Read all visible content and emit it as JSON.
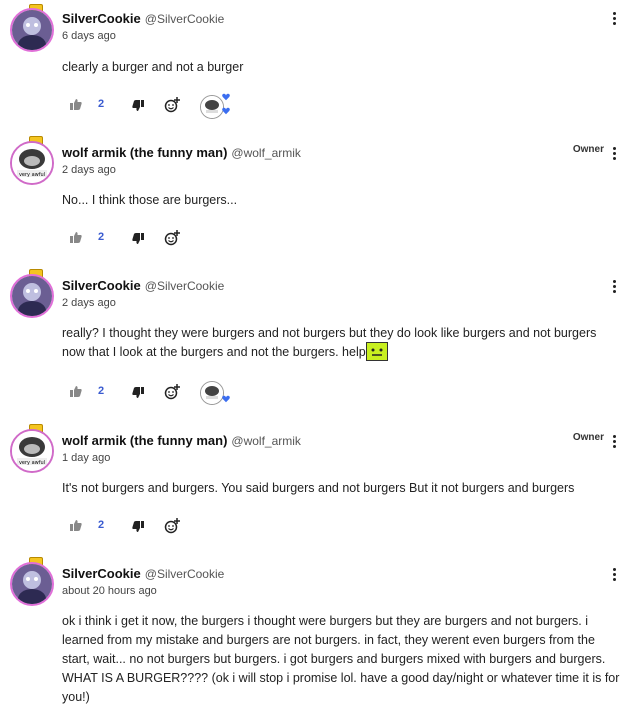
{
  "comments": [
    {
      "author": "SilverCookie",
      "handle": "@SilverCookie",
      "time": "6 days ago",
      "owner": "",
      "text": "clearly a burger and not a burger",
      "likes": "2",
      "avatar_type": "silver"
    },
    {
      "author": "wolf armik (the funny man)",
      "handle": "@wolf_armik",
      "time": "2 days ago",
      "owner": "Owner",
      "text": "No... I think those are burgers...",
      "likes": "2",
      "avatar_type": "wolf"
    },
    {
      "author": "SilverCookie",
      "handle": "@SilverCookie",
      "time": "2 days ago",
      "owner": "",
      "text": "really? I thought they were burgers and not burgers but they do look like burgers and not burgers now that I look at the burgers and not the burgers. help",
      "likes": "2",
      "avatar_type": "silver"
    },
    {
      "author": "wolf armik (the funny man)",
      "handle": "@wolf_armik",
      "time": "1 day ago",
      "owner": "Owner",
      "text": "It's not burgers and burgers. You said  burgers and not burgers But it not burgers and burgers",
      "likes": "2",
      "avatar_type": "wolf"
    },
    {
      "author": "SilverCookie",
      "handle": "@SilverCookie",
      "time": "about 20 hours ago",
      "owner": "",
      "text": "ok i think i get it now, the burgers i thought were burgers but they are burgers and not burgers. i learned from my mistake and burgers are not burgers. in fact, they werent even burgers from the start, wait... no not burgers but burgers. i got burgers and burgers mixed with burgers and burgers. WHAT IS A BURGER???? (ok i will stop i promise lol. have a good day/night or whatever time it is for you!)",
      "likes": "",
      "avatar_type": "silver"
    }
  ],
  "icons": {
    "like": "thumbs-up-icon",
    "dislike": "thumbs-down-icon",
    "react": "add-reaction-icon",
    "more": "more-vert-icon",
    "reacted_heart": "heart-icon"
  },
  "colors": {
    "count": "#3a5bd0",
    "heart": "#3b6ef0",
    "avatar_border": "#e06fd8",
    "emote": "#c8f020"
  }
}
